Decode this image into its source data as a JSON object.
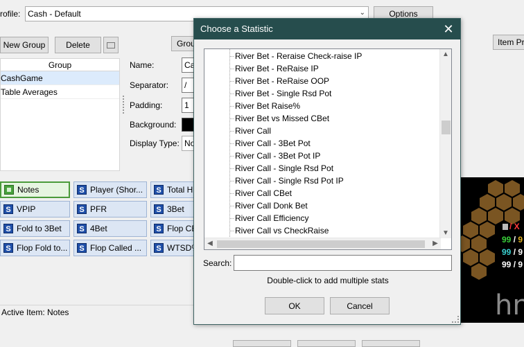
{
  "profile": {
    "label": "rofile:",
    "value": "Cash - Default",
    "options_label": "Options"
  },
  "toolbar": {
    "new_group": "New Group",
    "delete": "Delete",
    "group_btn": "Grou",
    "item_btn": "Item Pr"
  },
  "groups": {
    "header": "Group",
    "rows": [
      "CashGame",
      "Table Averages"
    ]
  },
  "properties": {
    "name_label": "Name:",
    "name_value": "Ca",
    "separator_label": "Separator:",
    "separator_value": "/",
    "padding_label": "Padding:",
    "padding_value": "1",
    "background_label": "Background:",
    "display_type_label": "Display Type:",
    "display_type_value": "No",
    "background_color": "#000000"
  },
  "tiles": [
    {
      "label": "Notes",
      "icon": "notes-icon"
    },
    {
      "label": "Player (Shor...",
      "icon": "stat-icon"
    },
    {
      "label": "Total H",
      "icon": "stat-icon"
    },
    {
      "label": "VPIP",
      "icon": "stat-icon"
    },
    {
      "label": "PFR",
      "icon": "stat-icon"
    },
    {
      "label": "3Bet",
      "icon": "stat-icon"
    },
    {
      "label": "Fold to 3Bet",
      "icon": "stat-icon"
    },
    {
      "label": "4Bet",
      "icon": "stat-icon"
    },
    {
      "label": "Flop CB",
      "icon": "stat-icon"
    },
    {
      "label": "Flop Fold to...",
      "icon": "stat-icon"
    },
    {
      "label": "Flop Called ...",
      "icon": "stat-icon"
    },
    {
      "label": "WTSD%",
      "icon": "stat-icon"
    }
  ],
  "status": {
    "active_item": "Active Item: Notes"
  },
  "hud": {
    "lines": [
      {
        "a": "99",
        "b": "9",
        "color_a": "#3ad23a"
      },
      {
        "a": "99",
        "b": "9",
        "color_a": "#3ad2d2"
      },
      {
        "a": "99",
        "b": "9",
        "color_a": "#ffffff"
      }
    ],
    "top_line_text": "/ X",
    "logo_text": "hn"
  },
  "dialog": {
    "title": "Choose a Statistic",
    "items": [
      "River Bet - Reraise Check-raise IP",
      "River Bet - ReRaise IP",
      "River Bet - ReRaise OOP",
      "River Bet - Single Rsd Pot",
      "River Bet Raise%",
      "River Bet vs Missed CBet",
      "River Call",
      "River Call - 3Bet Pot",
      "River Call - 3Bet Pot IP",
      "River Call - Single Rsd Pot",
      "River Call - Single Rsd Pot IP",
      "River Call CBet",
      "River Call Donk Bet",
      "River Call Efficiency",
      "River Call vs CheckRaise"
    ],
    "search_label": "Search:",
    "search_value": "",
    "hint": "Double-click to add multiple stats",
    "ok": "OK",
    "cancel": "Cancel"
  }
}
